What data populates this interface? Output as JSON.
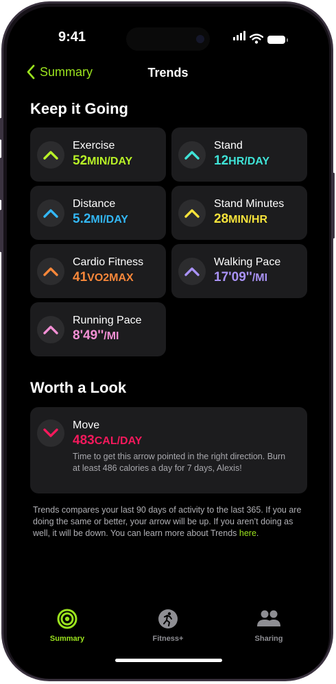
{
  "status_bar": {
    "time": "9:41"
  },
  "nav": {
    "back_label": "Summary",
    "title": "Trends"
  },
  "sections": {
    "keep_going": "Keep it Going",
    "worth_look": "Worth a Look"
  },
  "trends": [
    {
      "label": "Exercise",
      "value": "52",
      "unit": "MIN/DAY",
      "direction": "up",
      "color": "#b8f227"
    },
    {
      "label": "Stand",
      "value": "12",
      "unit": "HR/DAY",
      "direction": "up",
      "color": "#3fe3d7"
    },
    {
      "label": "Distance",
      "value": "5.2",
      "unit": "MI/DAY",
      "direction": "up",
      "color": "#33b7f5"
    },
    {
      "label": "Stand Minutes",
      "value": "28",
      "unit": "MIN/HR",
      "direction": "up",
      "color": "#f5e23b"
    },
    {
      "label": "Cardio Fitness",
      "value": "41",
      "unit": "VO2MAX",
      "direction": "up",
      "color": "#f7873a"
    },
    {
      "label": "Walking Pace",
      "value": "17'09''",
      "unit": "/MI",
      "direction": "up",
      "color": "#a992f5"
    },
    {
      "label": "Running Pace",
      "value": "8'49''",
      "unit": "/MI",
      "direction": "up",
      "color": "#f28fd4"
    }
  ],
  "worth": {
    "label": "Move",
    "value": "483",
    "unit": "CAL/DAY",
    "direction": "down",
    "color": "#f5195c",
    "description": "Time to get this arrow pointed in the right direction. Burn at least 486 calories a day for 7 days, Alexis!"
  },
  "footnote": {
    "text": "Trends compares your last 90 days of activity to the last 365. If you are doing the same or better, your arrow will be up. If you aren’t doing as well, it will be down. You can learn more about Trends ",
    "link": "here",
    "end": "."
  },
  "tabs": [
    {
      "label": "Summary",
      "icon": "summary-rings-icon",
      "active": true
    },
    {
      "label": "Fitness+",
      "icon": "fitness-plus-runner-icon",
      "active": false
    },
    {
      "label": "Sharing",
      "icon": "sharing-people-icon",
      "active": false
    }
  ],
  "colors": {
    "accent": "#9be31e",
    "card_bg": "#1c1c1e",
    "inactive_tab": "#8e8e93"
  }
}
